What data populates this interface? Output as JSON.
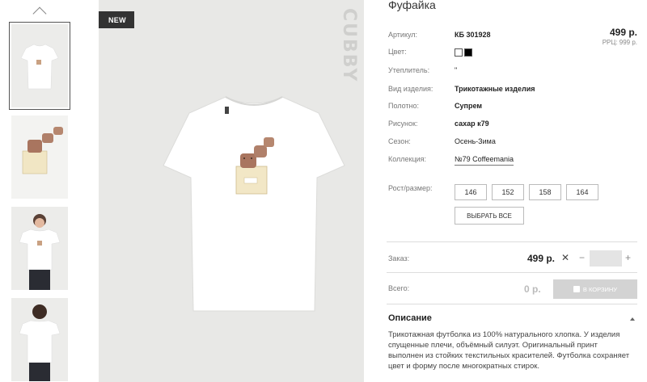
{
  "product": {
    "title": "Фуфайка",
    "badge": "NEW",
    "brand": "CUBBY",
    "price": "499 р.",
    "rrp": "РРЦ: 999 р."
  },
  "attributes": [
    {
      "label": "Артикул:",
      "value": "КБ 301928"
    },
    {
      "label": "Цвет:",
      "value": ""
    },
    {
      "label": "Утеплитель:",
      "value": "\""
    },
    {
      "label": "Вид изделия:",
      "value": "Трикотажные изделия"
    },
    {
      "label": "Полотно:",
      "value": "Супрем"
    },
    {
      "label": "Рисунок:",
      "value": "сахар к79"
    },
    {
      "label": "Сезон:",
      "value": "Осень-Зима"
    },
    {
      "label": "Коллекция:",
      "value": "№79 Coffeemania"
    }
  ],
  "colors": [
    "#ffffff",
    "#000000"
  ],
  "sizes": {
    "label": "Рост/размер:",
    "options": [
      "146",
      "152",
      "158",
      "164"
    ],
    "select_all": "ВЫБРАТЬ ВСЕ"
  },
  "order": {
    "label": "Заказ:",
    "price": "499 р.",
    "remove": "✕",
    "minus": "−",
    "plus": "+",
    "qty": ""
  },
  "total": {
    "label": "Всего:",
    "value": "0 р.",
    "cart_button": "В КОРЗИНУ"
  },
  "description": {
    "title": "Описание",
    "text": "Трикотажная футболка из 100% натурального хлопка. У изделия спущенные плечи, объёмный силуэт. Оригинальный принт выполнен из стойких текстильных красителей. Футболка сохраняет цвет и форму после многократных стирок."
  },
  "icons": {
    "thumb_up": "chevron-up-icon",
    "cart": "cart-icon",
    "desc_toggle": "chevron-up-icon"
  }
}
